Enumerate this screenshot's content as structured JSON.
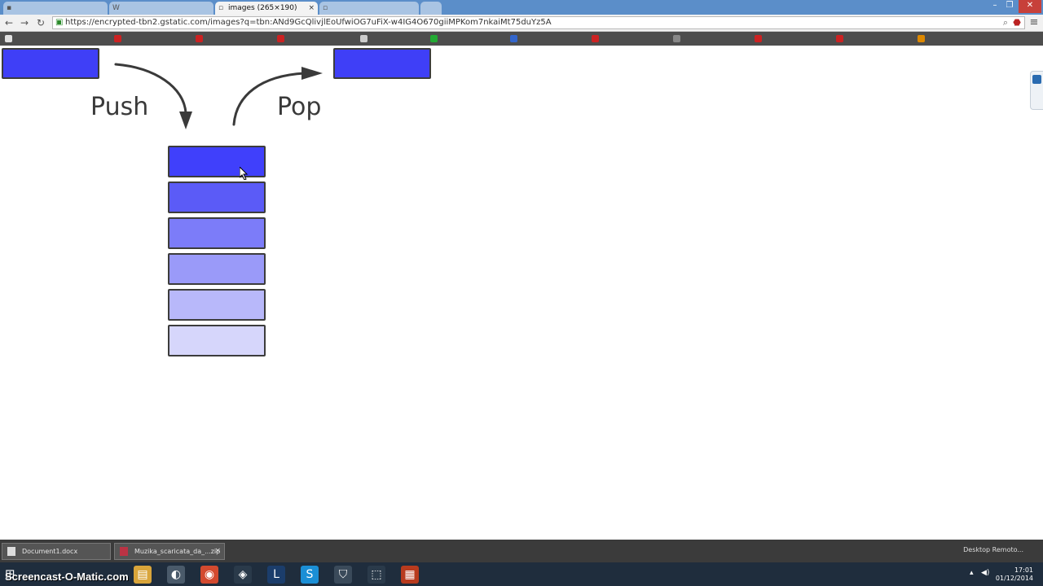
{
  "browser": {
    "tabs": [
      {
        "label": "",
        "active": false
      },
      {
        "label": "",
        "active": false
      },
      {
        "label": "images (265×190)",
        "active": true
      },
      {
        "label": "",
        "active": false
      }
    ],
    "tab_close_symbol": "×",
    "window_controls": {
      "minimize": "–",
      "maximize": "❐",
      "close": "✕"
    },
    "nav": {
      "back": "←",
      "forward": "→",
      "reload": "↻"
    },
    "url": "https://encrypted-tbn2.gstatic.com/images?q=tbn:ANd9GcQlivjlEoUfwiOG7uFiX-w4IG4O670giiMPKom7nkaiMt75duYz5A",
    "menu_icon": "≡",
    "bookmarks": [
      {
        "label": "",
        "color": "#e0e0e0"
      },
      {
        "label": "",
        "color": "#cc2222"
      },
      {
        "label": "",
        "color": "#cc2222"
      },
      {
        "label": "",
        "color": "#cc2222"
      },
      {
        "label": "",
        "color": "#cccccc"
      },
      {
        "label": "",
        "color": "#22aa33"
      },
      {
        "label": "",
        "color": "#3366cc"
      },
      {
        "label": "",
        "color": "#cc2222"
      },
      {
        "label": "",
        "color": "#888888"
      },
      {
        "label": "",
        "color": "#cc2222"
      },
      {
        "label": "",
        "color": "#cc2222"
      },
      {
        "label": "",
        "color": "#dd8800"
      }
    ]
  },
  "diagram": {
    "push_label": "Push",
    "pop_label": "Pop",
    "top_block_color": "#3f3ff7",
    "stack_colors": [
      "#4040fb",
      "#5b5bf7",
      "#7c7cf9",
      "#9a9af9",
      "#b8b8fa",
      "#d6d6fb"
    ],
    "border_color": "#3c3c3c",
    "arrow_color": "#3a3a3a"
  },
  "taskbar": {
    "windows": [
      {
        "label": "Document1.docx"
      },
      {
        "label": "Muzika_scaricata_da_...zip"
      }
    ],
    "remote_desktop_label": "Desktop Remoto...",
    "watermark": "Screencast-O-Matic.com",
    "pinned": [
      {
        "name": "folder-icon",
        "glyph": "▤",
        "color": "#d9a53b"
      },
      {
        "name": "media-icon",
        "glyph": "◐",
        "color": "#4a5a6a"
      },
      {
        "name": "chrome-icon",
        "glyph": "◉",
        "color": "#d34a2f"
      },
      {
        "name": "unity-icon",
        "glyph": "◈",
        "color": "#2a3a4a"
      },
      {
        "name": "league-icon",
        "glyph": "L",
        "color": "#1b3d6b"
      },
      {
        "name": "skype-icon",
        "glyph": "S",
        "color": "#1b8fd6"
      },
      {
        "name": "security-icon",
        "glyph": "⛉",
        "color": "#3a4a5a"
      },
      {
        "name": "snip-icon",
        "glyph": "⬚",
        "color": "#2a3a4a"
      },
      {
        "name": "office-icon",
        "glyph": "▦",
        "color": "#b83b1e"
      }
    ],
    "time": "17:01",
    "date": "01/12/2014"
  }
}
